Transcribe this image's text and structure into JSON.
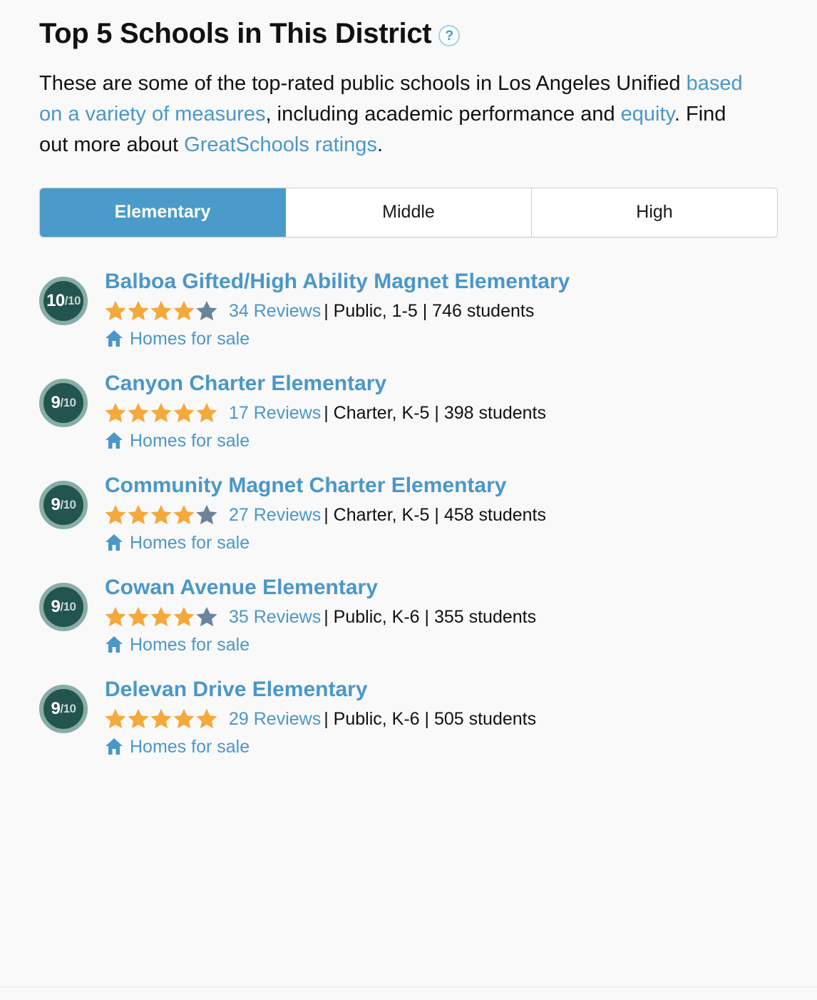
{
  "header": {
    "title": "Top 5 Schools in This District",
    "help_icon": "question-mark-icon",
    "help_glyph": "?"
  },
  "description": {
    "part1": "These are some of the top-rated public schools in Los Angeles Unified ",
    "link1": "based on a variety of measures",
    "part2": ", including academic performance and ",
    "link2": "equity",
    "part3": ". Find out more about ",
    "link3": "GreatSchools ratings",
    "part4": "."
  },
  "tabs": [
    {
      "label": "Elementary",
      "active": true
    },
    {
      "label": "Middle",
      "active": false
    },
    {
      "label": "High",
      "active": false
    }
  ],
  "colors": {
    "accent_blue": "#4a97c9",
    "tab_active_blue": "#4a9bc9",
    "badge_inner_green": "#235450",
    "badge_ring_green": "#88ada7",
    "star_gold": "#f4a93c",
    "star_gray": "#6b8499",
    "page_background": "#f9f9f9"
  },
  "homes_label": "Homes for sale",
  "schools": [
    {
      "score": "10",
      "out_of": "/10",
      "name": "Balboa Gifted/High Ability Magnet Elementary",
      "stars_filled": 4,
      "stars_total": 5,
      "reviews": "34 Reviews",
      "meta": "| Public, 1-5 | 746 students",
      "homes": "Homes for sale"
    },
    {
      "score": "9",
      "out_of": "/10",
      "name": "Canyon Charter Elementary",
      "stars_filled": 5,
      "stars_total": 5,
      "reviews": "17 Reviews",
      "meta": "| Charter, K-5 | 398 students",
      "homes": "Homes for sale"
    },
    {
      "score": "9",
      "out_of": "/10",
      "name": "Community Magnet Charter Elementary",
      "stars_filled": 4,
      "stars_total": 5,
      "reviews": "27 Reviews",
      "meta": "| Charter, K-5 | 458 students",
      "homes": "Homes for sale"
    },
    {
      "score": "9",
      "out_of": "/10",
      "name": "Cowan Avenue Elementary",
      "stars_filled": 4,
      "stars_total": 5,
      "reviews": "35 Reviews",
      "meta": "| Public, K-6 | 355 students",
      "homes": "Homes for sale"
    },
    {
      "score": "9",
      "out_of": "/10",
      "name": "Delevan Drive Elementary",
      "stars_filled": 5,
      "stars_total": 5,
      "reviews": "29 Reviews",
      "meta": "| Public, K-6 | 505 students",
      "homes": "Homes for sale"
    }
  ]
}
